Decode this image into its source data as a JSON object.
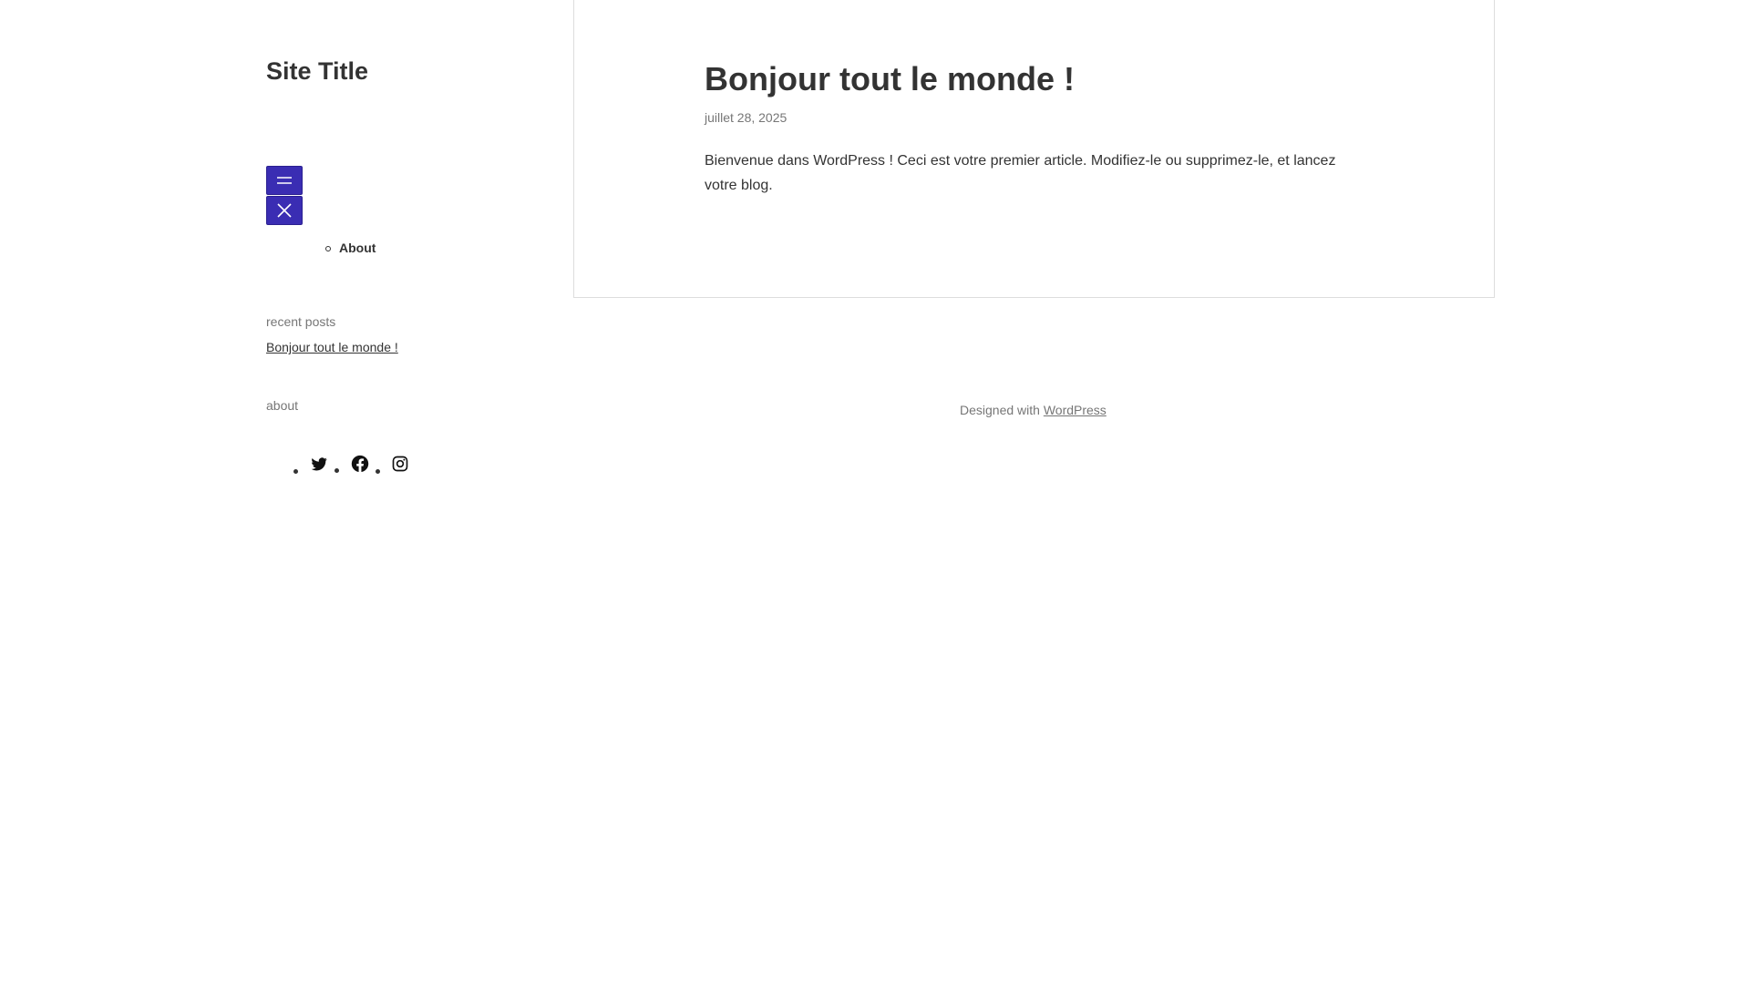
{
  "site": {
    "title": "Site Title"
  },
  "nav": {
    "items": [
      {
        "label": "About"
      }
    ]
  },
  "widgets": {
    "recent_posts_title": "recent posts",
    "recent_posts": [
      {
        "label": "Bonjour tout le monde !"
      }
    ],
    "about_title": "about",
    "social_icons": [
      "twitter-icon",
      "facebook-icon",
      "instagram-icon"
    ]
  },
  "post": {
    "title": "Bonjour tout le monde !",
    "date": "juillet 28, 2025",
    "body": "Bienvenue dans WordPress ! Ceci est votre premier article. Modifiez-le ou supprimez-le, et lancez votre blog."
  },
  "footer": {
    "prefix": "Designed with ",
    "link_label": "WordPress"
  },
  "colors": {
    "menu_button": "#3a2db3",
    "text": "#333333",
    "muted": "#767676",
    "border": "#dddddd"
  }
}
